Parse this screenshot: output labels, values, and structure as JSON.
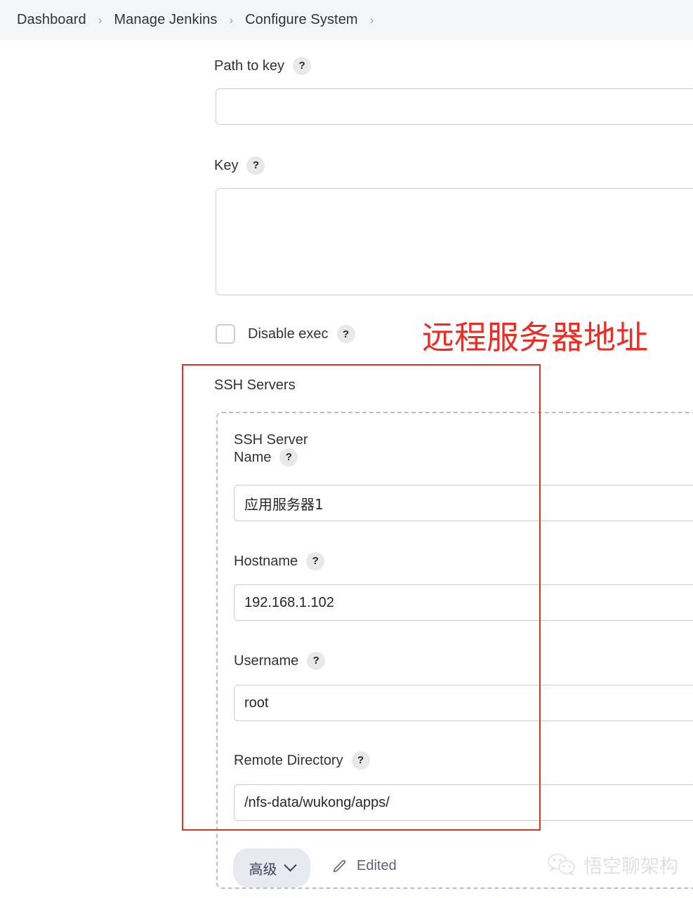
{
  "breadcrumb": {
    "items": [
      {
        "label": "Dashboard"
      },
      {
        "label": "Manage Jenkins"
      },
      {
        "label": "Configure System"
      }
    ],
    "separator": "›"
  },
  "form": {
    "help_glyph": "?",
    "path_to_key": {
      "label": "Path to key",
      "value": "",
      "placeholder": ""
    },
    "key": {
      "label": "Key",
      "value": "",
      "placeholder": ""
    },
    "disable_exec": {
      "label": "Disable exec",
      "checked": false
    }
  },
  "annotation": {
    "text": "远程服务器地址",
    "color": "#ed2d24"
  },
  "ssh_servers": {
    "section_title": "SSH Servers",
    "server": {
      "name": {
        "label_line1": "SSH Server",
        "label_line2": "Name",
        "value": "应用服务器1"
      },
      "hostname": {
        "label": "Hostname",
        "value": "192.168.1.102"
      },
      "username": {
        "label": "Username",
        "value": "root"
      },
      "remote_directory": {
        "label": "Remote Directory",
        "value": "/nfs-data/wukong/apps/"
      }
    }
  },
  "footer": {
    "advanced_button": "高级",
    "edited_label": "Edited"
  },
  "watermark": {
    "text": "悟空聊架构"
  }
}
